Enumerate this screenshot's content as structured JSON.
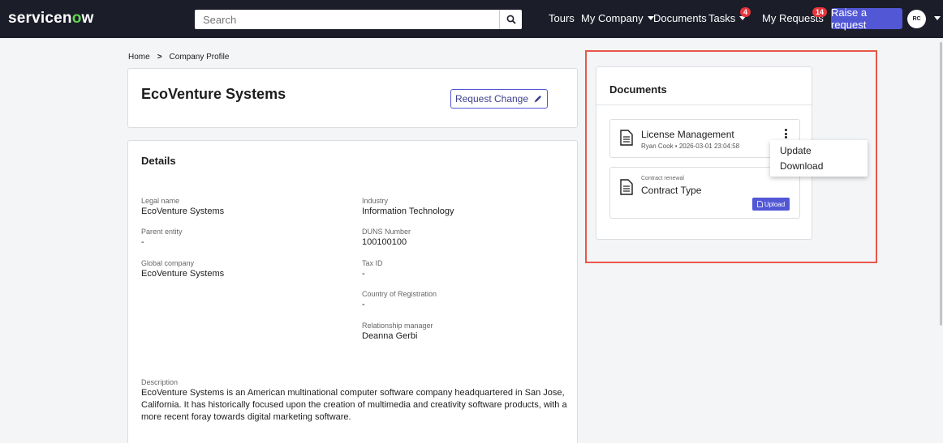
{
  "topbar": {
    "logo_main": "servicen",
    "logo_o": "o",
    "logo_tail": "w",
    "search_placeholder": "Search",
    "nav": {
      "tours": "Tours",
      "my_company": "My Company",
      "documents": "Documents",
      "tasks": "Tasks",
      "tasks_badge": "4",
      "my_requests": "My Requests",
      "my_requests_badge": "14",
      "raise_request": "Raise a request",
      "avatar_initials": "RC"
    }
  },
  "breadcrumb": {
    "home": "Home",
    "current": "Company Profile"
  },
  "company": {
    "name": "EcoVenture Systems",
    "request_change_label": "Request Change"
  },
  "details": {
    "title": "Details",
    "legal_name_label": "Legal name",
    "legal_name": "EcoVenture Systems",
    "parent_entity_label": "Parent entity",
    "parent_entity": "-",
    "global_company_label": "Global company",
    "global_company": "EcoVenture Systems",
    "industry_label": "Industry",
    "industry": "Information Technology",
    "duns_label": "DUNS Number",
    "duns": "100100100",
    "tax_id_label": "Tax ID",
    "tax_id": "-",
    "country_label": "Country of Registration",
    "country": "-",
    "rel_manager_label": "Relationship manager",
    "rel_manager": "Deanna Gerbi",
    "description_label": "Description",
    "description": "EcoVenture Systems is an American multinational computer software company headquartered in San Jose, California. It has historically focused upon the creation of multimedia and creativity software products, with a more recent foray towards digital marketing software."
  },
  "documents": {
    "title": "Documents",
    "items": [
      {
        "name": "License Management",
        "author": "Ryan Cook",
        "timestamp": "2026-03-01 23:04:58"
      },
      {
        "category": "Contract renewal",
        "name": "Contract Type",
        "upload_label": "Upload"
      }
    ],
    "menu": {
      "update": "Update",
      "download": "Download"
    }
  },
  "colors": {
    "topbar_bg": "#1b1d29",
    "accent": "#5257d5",
    "badge": "#e8363d",
    "highlight": "#e8564a",
    "logo_o": "#62d84e"
  }
}
